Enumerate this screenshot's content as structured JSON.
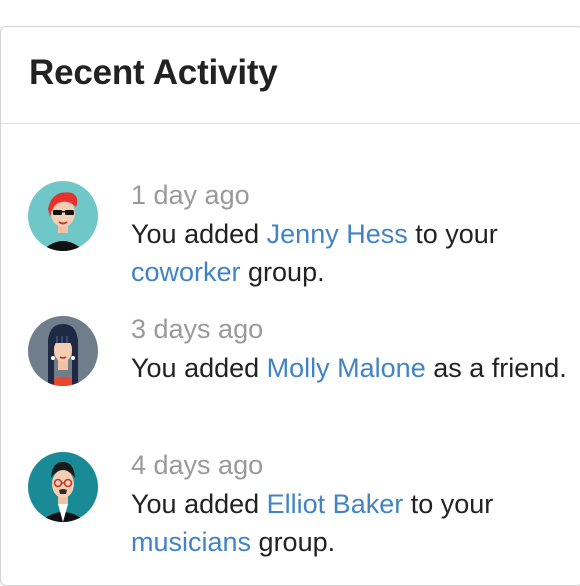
{
  "card": {
    "title": "Recent Activity"
  },
  "events": [
    {
      "avatar": "avatar-woman-red-hair-icon",
      "date": "1 day ago",
      "text_before": "You added ",
      "person": "Jenny Hess",
      "text_middle": " to your ",
      "group": "coworker",
      "text_after": " group."
    },
    {
      "avatar": "avatar-woman-dark-hair-icon",
      "date": "3 days ago",
      "text_before": "You added ",
      "person": "Molly Malone",
      "text_middle": " as a friend.",
      "group": "",
      "text_after": ""
    },
    {
      "avatar": "avatar-man-glasses-icon",
      "date": "4 days ago",
      "text_before": "You added ",
      "person": "Elliot Baker",
      "text_middle": " to your ",
      "group": "musicians",
      "text_after": " group."
    }
  ],
  "colors": {
    "link": "#4183c4",
    "date": "#9a9a9a",
    "text": "#222222"
  }
}
